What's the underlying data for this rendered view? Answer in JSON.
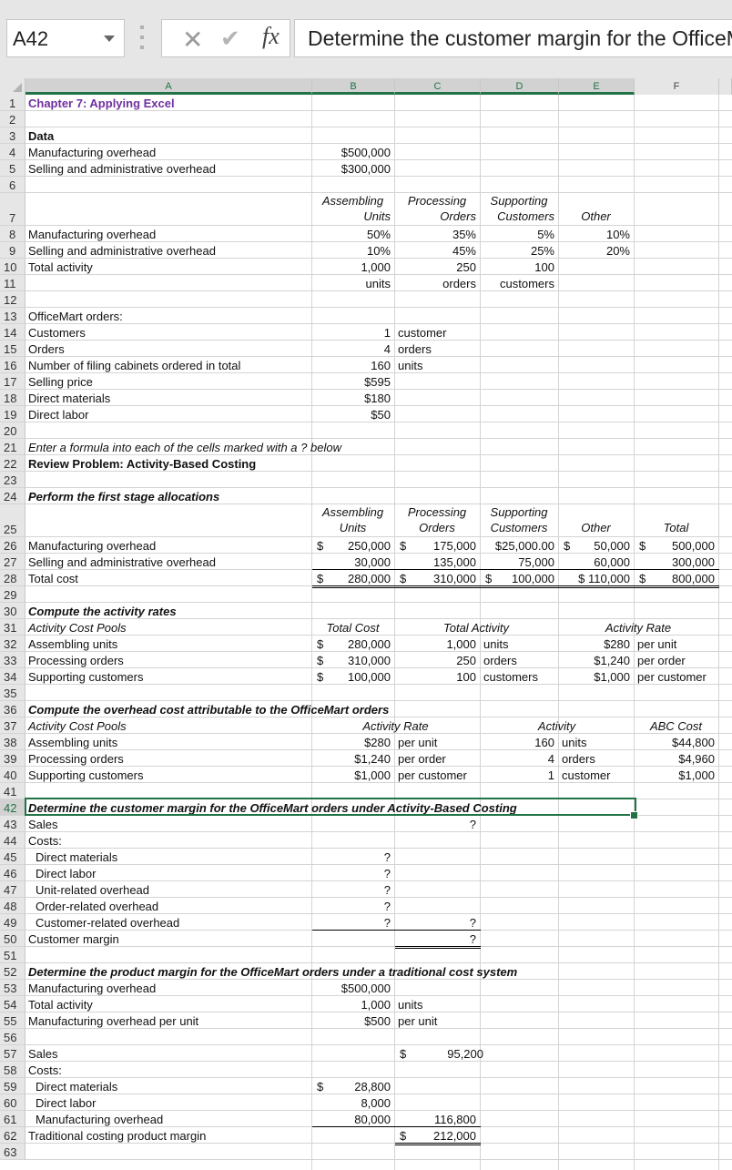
{
  "formula_bar": {
    "name_box": "A42",
    "cancel_icon": "x-icon",
    "enter_icon": "checkmark-icon",
    "fx_label": "fx",
    "formula_text": "Determine the customer margin for the OfficeMart orders under Activity-Based Costing"
  },
  "columns": [
    "A",
    "B",
    "C",
    "D",
    "E",
    "F"
  ],
  "selected_column_range": [
    "A",
    "B",
    "C",
    "D",
    "E"
  ],
  "rows": [
    "1",
    "2",
    "3",
    "4",
    "5",
    "6",
    "7",
    "8",
    "9",
    "10",
    "11",
    "12",
    "13",
    "14",
    "15",
    "16",
    "17",
    "18",
    "19",
    "20",
    "21",
    "22",
    "23",
    "24",
    "25",
    "26",
    "27",
    "28",
    "29",
    "30",
    "31",
    "32",
    "33",
    "34",
    "35",
    "36",
    "37",
    "38",
    "39",
    "40",
    "41",
    "42",
    "43",
    "44",
    "45",
    "46",
    "47",
    "48",
    "49",
    "50",
    "51",
    "52",
    "53",
    "54",
    "55",
    "56",
    "57",
    "58",
    "59",
    "60",
    "61",
    "62",
    "63"
  ],
  "selected_row": "42",
  "sheet": {
    "title": "Chapter 7: Applying Excel",
    "data_heading": "Data",
    "r4": {
      "label": "Manufacturing overhead",
      "value": "$500,000"
    },
    "r5": {
      "label": "Selling and administrative overhead",
      "value": "$300,000"
    },
    "r7": {
      "b": [
        "Assembling",
        "Units"
      ],
      "c": [
        "Processing",
        "Orders"
      ],
      "d": [
        "Supporting",
        "Customers"
      ],
      "e": "Other"
    },
    "r8": {
      "label": "Manufacturing overhead",
      "b": "50%",
      "c": "35%",
      "d": "5%",
      "e": "10%"
    },
    "r9": {
      "label": "Selling and administrative overhead",
      "b": "10%",
      "c": "45%",
      "d": "25%",
      "e": "20%"
    },
    "r10": {
      "label": "Total activity",
      "b": "1,000",
      "c": "250",
      "d": "100"
    },
    "r11": {
      "b": "units",
      "c": "orders",
      "d": "customers"
    },
    "r13": {
      "label": "OfficeMart orders:"
    },
    "r14": {
      "label": "Customers",
      "b": "1",
      "c": "customer"
    },
    "r15": {
      "label": "Orders",
      "b": "4",
      "c": "orders"
    },
    "r16": {
      "label": "Number of filing cabinets ordered in total",
      "b": "160",
      "c": "units"
    },
    "r17": {
      "label": "Selling price",
      "b": "$595"
    },
    "r18": {
      "label": "Direct materials",
      "b": "$180"
    },
    "r19": {
      "label": "Direct labor",
      "b": "$50"
    },
    "r21": {
      "label": "Enter a formula into each of the cells marked with a ? below"
    },
    "r22": {
      "label": "Review Problem: Activity-Based Costing"
    },
    "r24": {
      "label": "Perform the first stage allocations"
    },
    "r25": {
      "b": [
        "Assembling",
        "Units"
      ],
      "c": [
        "Processing",
        "Orders"
      ],
      "d": [
        "Supporting",
        "Customers"
      ],
      "e": "Other",
      "f": "Total"
    },
    "r26": {
      "label": "Manufacturing overhead",
      "b": "250,000",
      "c": "175,000",
      "d": "$25,000.00",
      "e": "50,000",
      "f": "500,000"
    },
    "r27": {
      "label": "Selling and administrative overhead",
      "b": "30,000",
      "c": "135,000",
      "d": "75,000",
      "e": "60,000",
      "f": "300,000"
    },
    "r28": {
      "label": "Total cost",
      "b": "280,000",
      "c": "310,000",
      "d": "100,000",
      "e": "$ 110,000",
      "f": "800,000"
    },
    "currency_symbol": "$",
    "r30": {
      "label": "Compute the activity rates"
    },
    "r31": {
      "label": "Activity Cost Pools",
      "b": "Total Cost",
      "cd": "Total Activity",
      "ef": "Activity Rate"
    },
    "r32": {
      "label": "Assembling units",
      "b": "280,000",
      "c": "1,000",
      "d": "units",
      "e": "$280",
      "f": "per unit"
    },
    "r33": {
      "label": "Processing orders",
      "b": "310,000",
      "c": "250",
      "d": "orders",
      "e": "$1,240",
      "f": "per order"
    },
    "r34": {
      "label": "Supporting customers",
      "b": "100,000",
      "c": "100",
      "d": "customers",
      "e": "$1,000",
      "f": "per customer"
    },
    "r36": {
      "label": "Compute the overhead cost attributable to the OfficeMart orders"
    },
    "r37": {
      "label": "Activity Cost Pools",
      "bc": "Activity Rate",
      "de": "Activity",
      "f": "ABC Cost"
    },
    "r38": {
      "label": "Assembling units",
      "b": "$280",
      "c": "per unit",
      "d": "160",
      "e": "units",
      "f": "$44,800"
    },
    "r39": {
      "label": "Processing orders",
      "b": "$1,240",
      "c": "per order",
      "d": "4",
      "e": "orders",
      "f": "$4,960"
    },
    "r40": {
      "label": "Supporting customers",
      "b": "$1,000",
      "c": "per customer",
      "d": "1",
      "e": "customer",
      "f": "$1,000"
    },
    "r42": {
      "label": "Determine the customer margin for the OfficeMart orders under Activity-Based Costing"
    },
    "r43": {
      "label": "Sales",
      "c": "?"
    },
    "r44": {
      "label": "Costs:"
    },
    "r45": {
      "label": "Direct materials",
      "b": "?"
    },
    "r46": {
      "label": "Direct labor",
      "b": "?"
    },
    "r47": {
      "label": "Unit-related overhead",
      "b": "?"
    },
    "r48": {
      "label": "Order-related overhead",
      "b": "?"
    },
    "r49": {
      "label": "Customer-related overhead",
      "b": "?",
      "c": "?"
    },
    "r50": {
      "label": "Customer margin",
      "c": "?"
    },
    "r52": {
      "label": "Determine the product margin for the OfficeMart orders under a traditional cost system"
    },
    "r53": {
      "label": "Manufacturing overhead",
      "b": "$500,000"
    },
    "r54": {
      "label": "Total activity",
      "b": "1,000",
      "c": "units"
    },
    "r55": {
      "label": "Manufacturing overhead per unit",
      "b": "$500",
      "c": "per unit"
    },
    "r57": {
      "label": "Sales",
      "c": "95,200"
    },
    "r58": {
      "label": "Costs:"
    },
    "r59": {
      "label": "Direct materials",
      "b": "28,800"
    },
    "r60": {
      "label": "Direct labor",
      "b": "8,000"
    },
    "r61": {
      "label": "Manufacturing overhead",
      "b": "80,000",
      "c": "116,800"
    },
    "r62": {
      "label": "Traditional costing product margin",
      "c": "212,000"
    }
  },
  "colors": {
    "selection": "#217346",
    "title": "#7030a0"
  }
}
